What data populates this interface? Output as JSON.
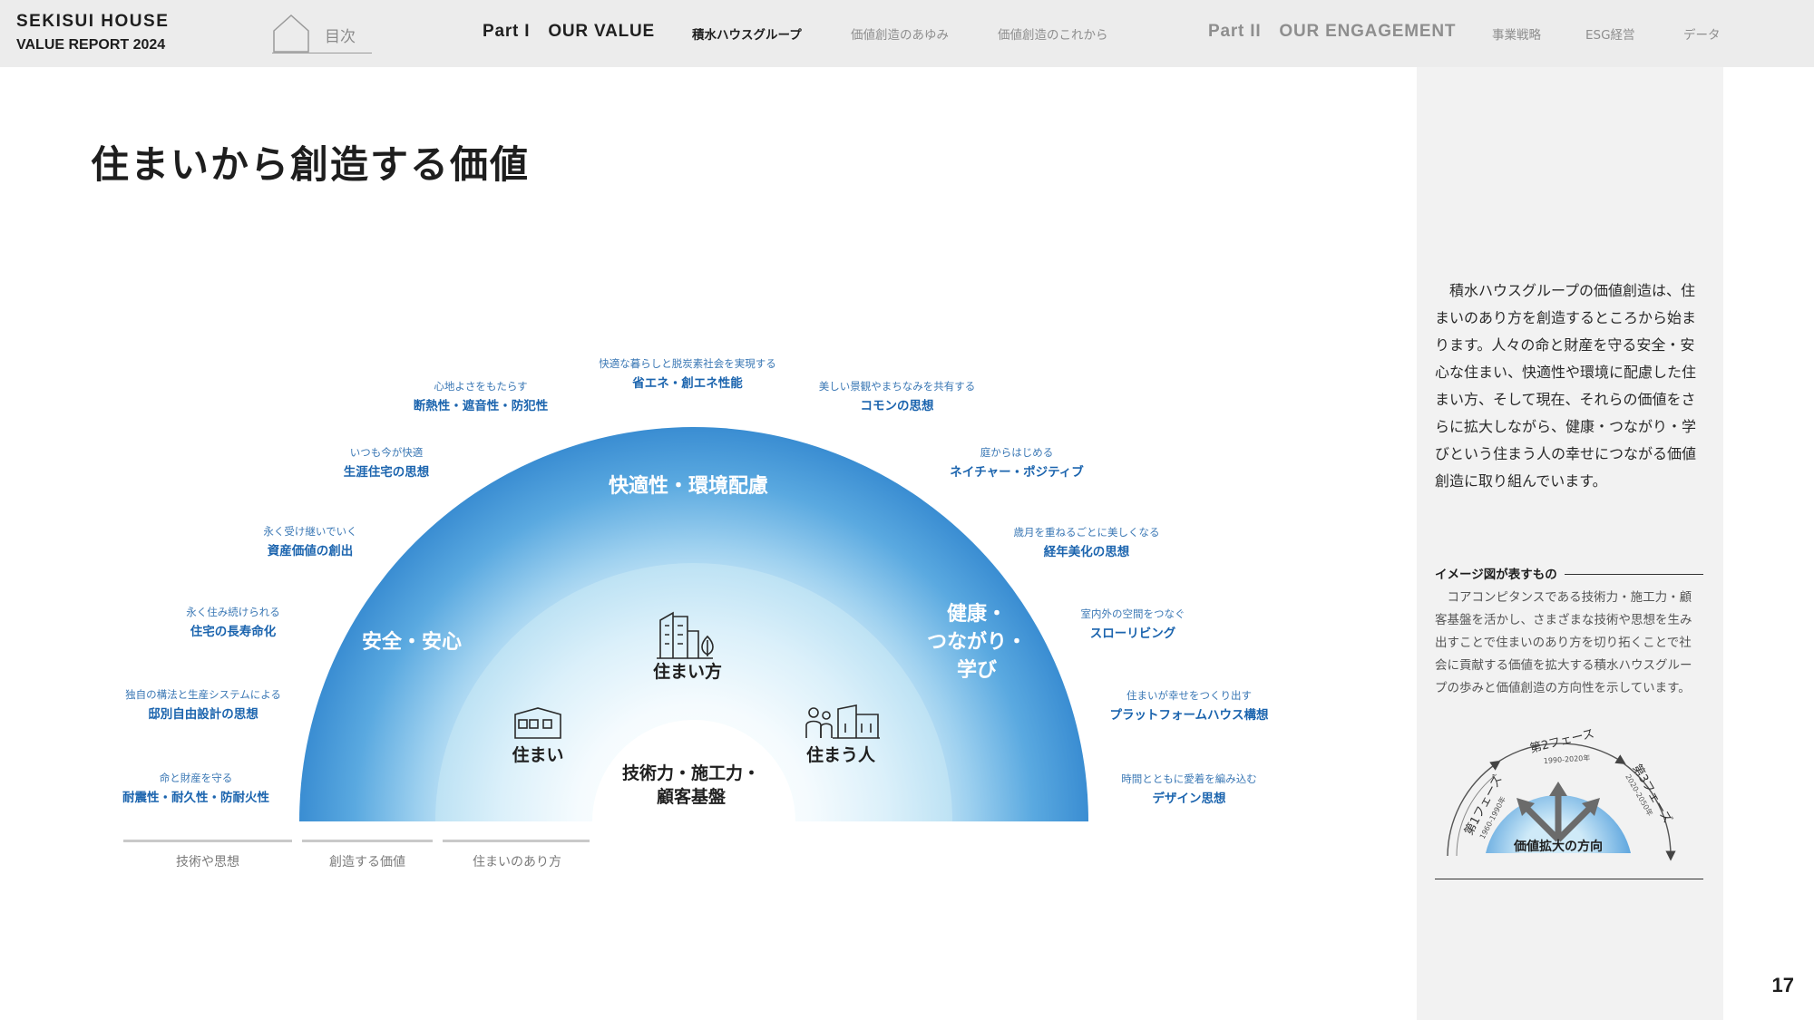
{
  "header": {
    "brand_line1": "SEKISUI HOUSE",
    "brand_line2": "VALUE REPORT 2024",
    "toc_label": "目次",
    "part1_prefix": "Part I",
    "part1_title": "OUR VALUE",
    "part1_items": [
      "積水ハウスグループ",
      "価値創造のあゆみ",
      "価値創造のこれから"
    ],
    "part2_prefix": "Part II",
    "part2_title": "OUR ENGAGEMENT",
    "part2_items": [
      "事業戦略",
      "ESG経営",
      "データ"
    ]
  },
  "page_title": "住まいから創造する価値",
  "diagram": {
    "outer_labels": {
      "left": "安全・安心",
      "top": "快適性・環境配慮",
      "right_lines": [
        "健康・",
        "つながり・",
        "学び"
      ]
    },
    "inner_labels": {
      "center_top": "住まい方",
      "left": "住まい",
      "right": "住まう人",
      "core_lines": [
        "技術力・施工力・",
        "顧客基盤"
      ]
    },
    "annotations": [
      {
        "sub": "命と財産を守る",
        "title": "耐震性・耐久性・防耐火性"
      },
      {
        "sub": "独自の構法と生産システムによる",
        "title": "邸別自由設計の思想"
      },
      {
        "sub": "永く住み続けられる",
        "title": "住宅の長寿命化"
      },
      {
        "sub": "永く受け継いでいく",
        "title": "資産価値の創出"
      },
      {
        "sub": "いつも今が快適",
        "title": "生涯住宅の思想"
      },
      {
        "sub": "心地よさをもたらす",
        "title": "断熱性・遮音性・防犯性"
      },
      {
        "sub": "快適な暮らしと脱炭素社会を実現する",
        "title": "省エネ・創エネ性能"
      },
      {
        "sub": "美しい景観やまちなみを共有する",
        "title": "コモンの思想"
      },
      {
        "sub": "庭からはじめる",
        "title": "ネイチャー・ポジティブ"
      },
      {
        "sub": "歳月を重ねるごとに美しくなる",
        "title": "経年美化の思想"
      },
      {
        "sub": "室内外の空間をつなぐ",
        "title": "スローリビング"
      },
      {
        "sub": "住まいが幸せをつくり出す",
        "title": "プラットフォームハウス構想"
      },
      {
        "sub": "時間とともに愛着を編み込む",
        "title": "デザイン思想"
      }
    ],
    "legend": [
      "技術や思想",
      "創造する価値",
      "住まいのあり方"
    ],
    "colors": {
      "outer_band": "#3f93d6",
      "inner_band": "#bfe3f5",
      "label_blue": "#1b64ae"
    }
  },
  "side": {
    "body": "積水ハウスグループの価値創造は、住まいのあり方を創造するところから始まります。人々の命と財産を守る安全・安心な住まい、快適性や環境に配慮した住まい方、そして現在、それらの価値をさらに拡大しながら、健康・つながり・学びという住まう人の幸せにつながる価値創造に取り組んでいます。",
    "image_heading": "イメージ図が表すもの",
    "image_body": "コアコンピタンスである技術力・施工力・顧客基盤を活かし、さまざまな技術や思想を生み出すことで住まいのあり方を切り拓くことで社会に貢献する価値を拡大する積水ハウスグループの歩みと価値創造の方向性を示しています。",
    "mini": {
      "phase1": "第1フェーズ",
      "phase1_years": "1960-1990年",
      "phase2": "第2フェーズ",
      "phase2_years": "1990-2020年",
      "phase3": "第3フェーズ",
      "phase3_years": "2020-2050年",
      "caption": "価値拡大の方向"
    }
  },
  "page_number": "17"
}
